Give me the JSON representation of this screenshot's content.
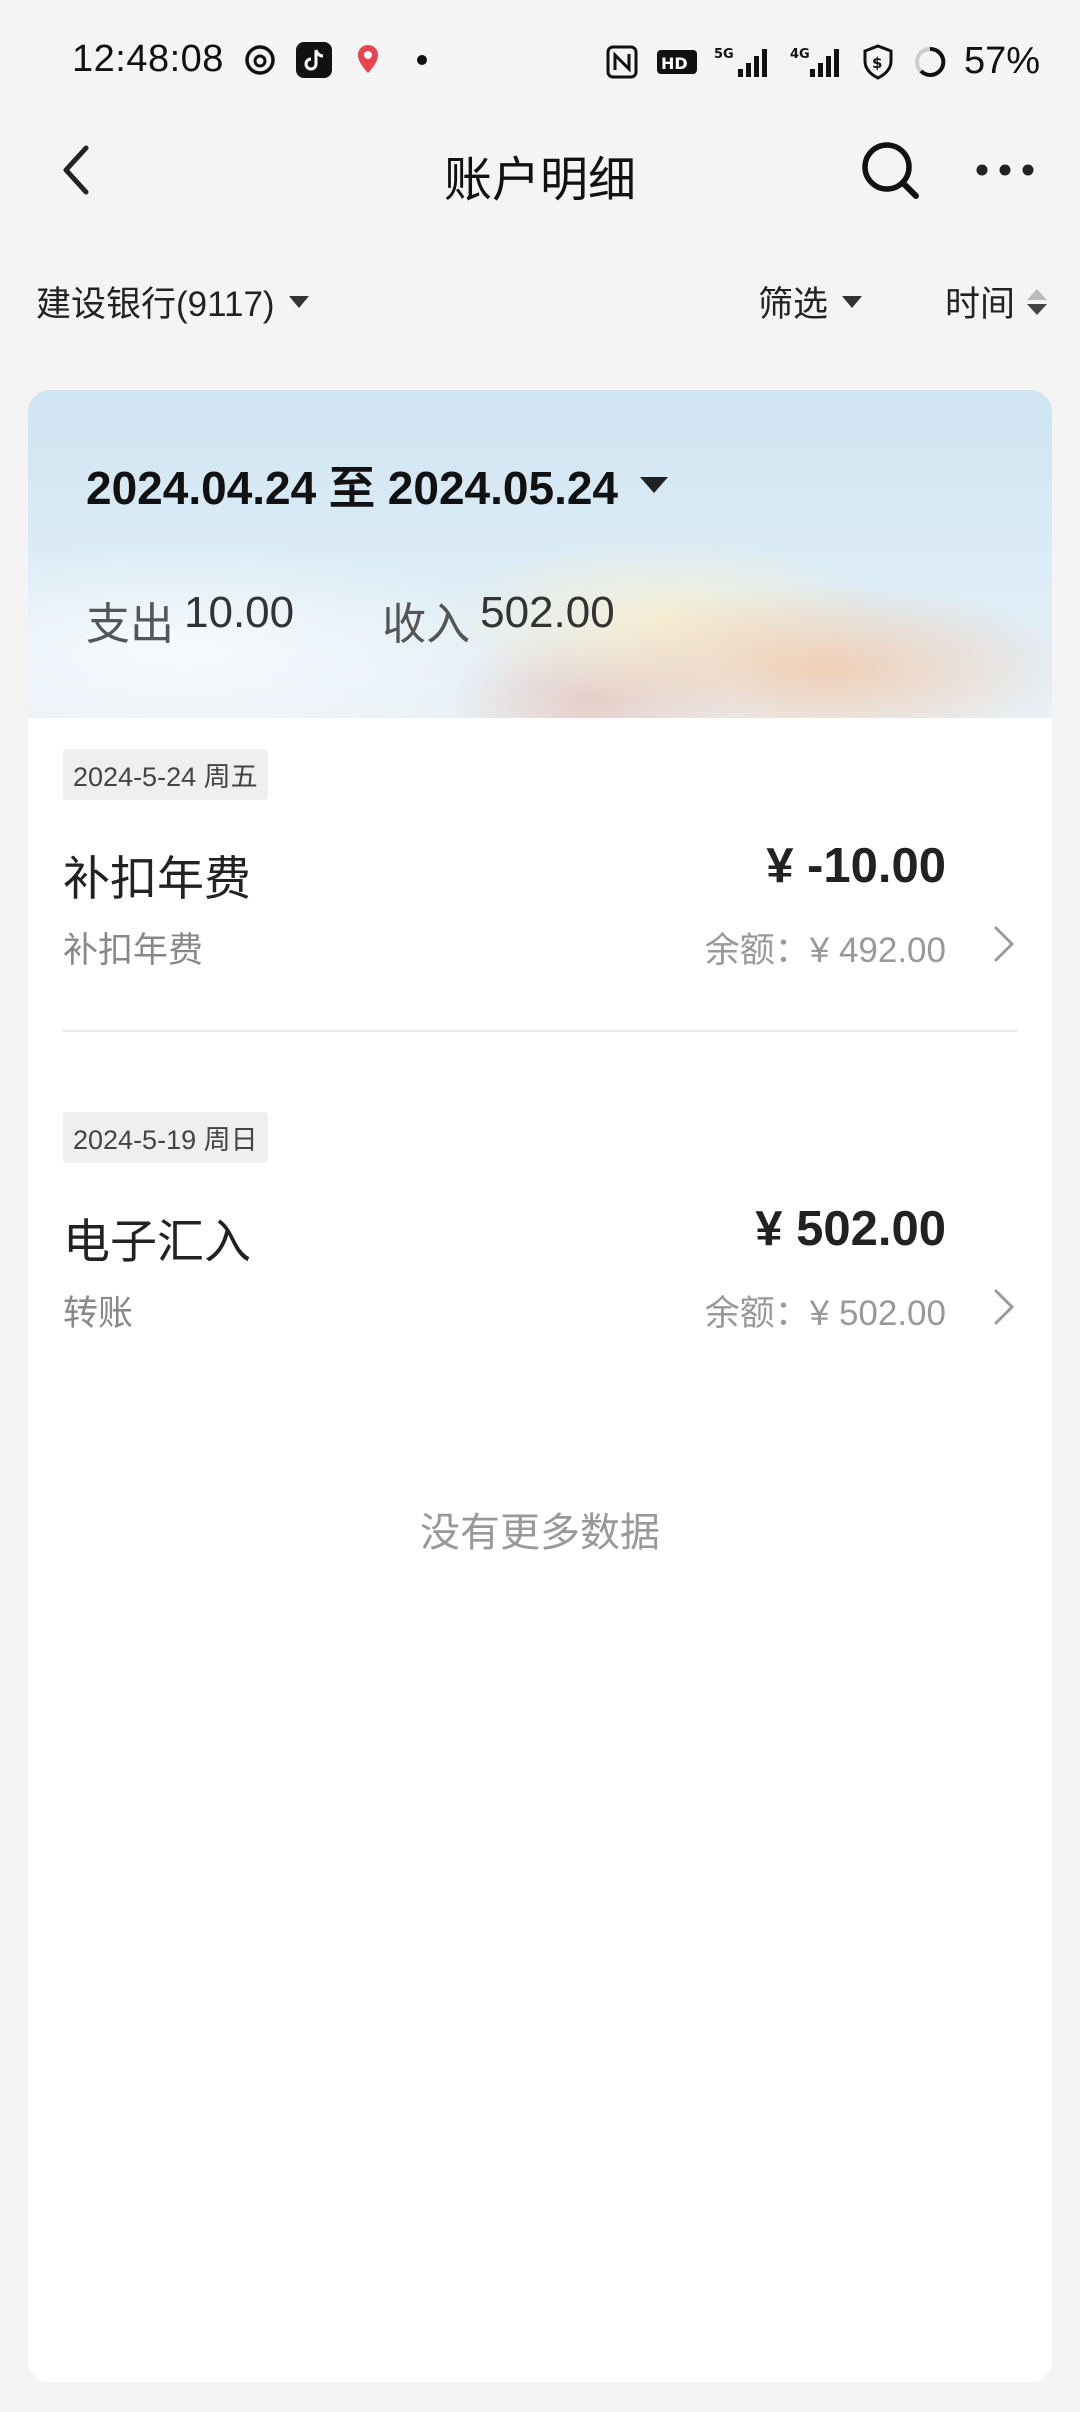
{
  "status_bar": {
    "time": "12:48:08",
    "left_icons": [
      "netease-music-icon",
      "douyin-icon",
      "location-pin-icon",
      "dot-icon"
    ],
    "right_icons": [
      "nfc-icon",
      "hd-icon",
      "5g-signal-icon",
      "4g-signal-icon",
      "shield-dollar-icon",
      "battery-ring-icon"
    ],
    "battery": "57%"
  },
  "app_bar": {
    "title": "账户明细"
  },
  "filter_bar": {
    "account": "建设银行(9117)",
    "filter_label": "筛选",
    "sort_label": "时间"
  },
  "summary": {
    "date_range": "2024.04.24 至 2024.05.24",
    "expense_label": "支出",
    "expense_value": "10.00",
    "income_label": "收入",
    "income_value": "502.00"
  },
  "transactions": [
    {
      "date": "2024-5-24 周五",
      "title": "补扣年费",
      "amount": "¥ -10.00",
      "subtitle": "补扣年费",
      "balance": "余额：¥ 492.00"
    },
    {
      "date": "2024-5-19 周日",
      "title": "电子汇入",
      "amount": "¥ 502.00",
      "subtitle": "转账",
      "balance": "余额：¥ 502.00"
    }
  ],
  "footer_text": "没有更多数据"
}
